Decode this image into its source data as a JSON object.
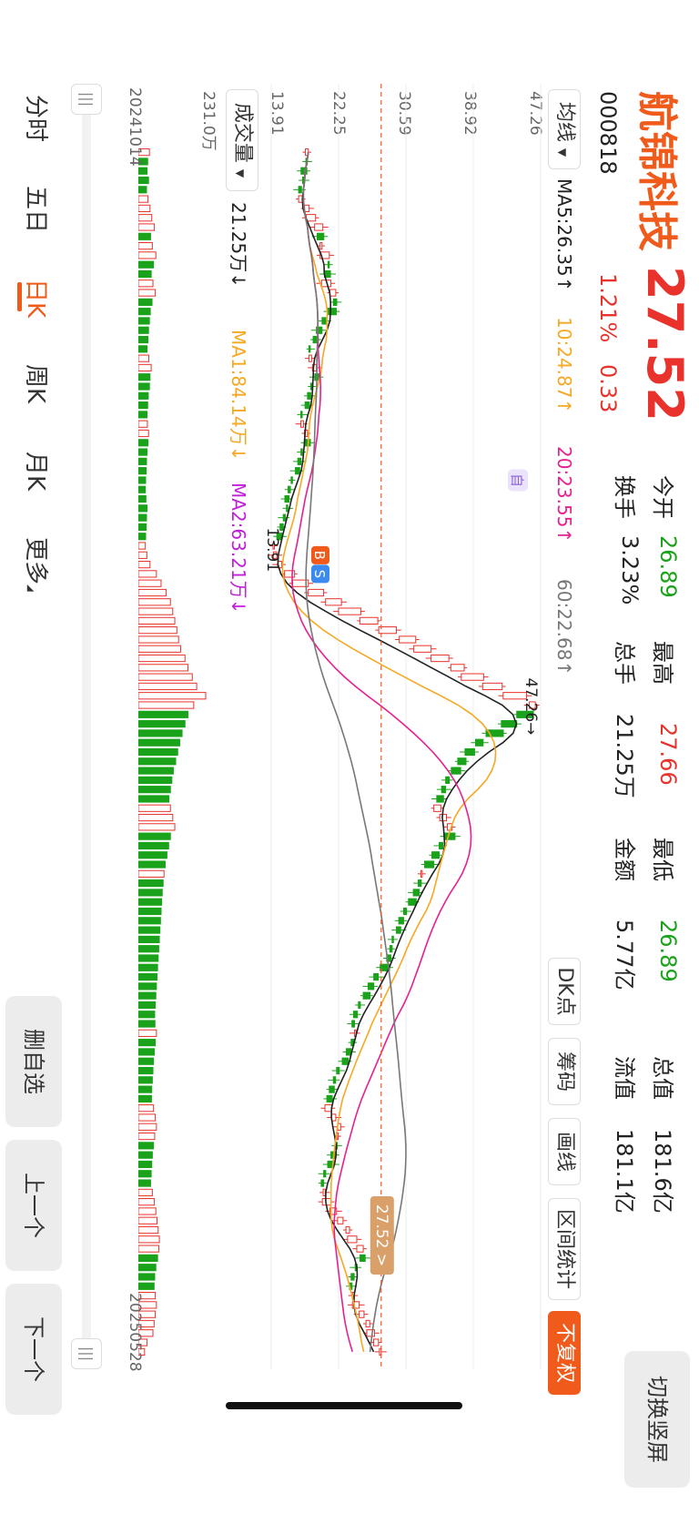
{
  "stock": {
    "name": "航锦科技",
    "code": "000818",
    "price": "27.52",
    "change_pct": "1.21%",
    "change_amt": "0.33"
  },
  "quote": {
    "open_label": "今开",
    "open": "26.89",
    "high_label": "最高",
    "high": "27.66",
    "low_label": "最低",
    "low": "26.89",
    "total_label": "总值",
    "total": "181.6亿",
    "turnover_label": "换手",
    "turnover": "3.23%",
    "volume_label": "总手",
    "volume": "21.25万",
    "amount_label": "金额",
    "amount": "5.77亿",
    "float_label": "流值",
    "float": "181.1亿"
  },
  "switch_btn": "切换竖屏",
  "toolbar": {
    "ma_select": "均线",
    "dk": "DK点",
    "chips": "筹码",
    "draw": "画线",
    "range": "区间统计",
    "fq": "不复权"
  },
  "ma_values": {
    "ma5": "MA5:26.35↑",
    "ma10": "10:24.87↑",
    "ma20": "20:23.55↑",
    "ma60": "60:22.68↑"
  },
  "price_axis": {
    "t1": "47.26",
    "t2": "38.92",
    "t3": "30.59",
    "t4": "22.25",
    "t5": "13.91"
  },
  "annotations": {
    "max": "47.26",
    "min": "13.91",
    "last": "27.52",
    "self": "自",
    "buy": "B",
    "sell": "S"
  },
  "volume": {
    "select": "成交量",
    "value": "21.25万↓",
    "ma1": "MA1:84.14万↓",
    "ma2": "MA2:63.21万↓",
    "axis_top": "231.0万"
  },
  "dates": {
    "start": "20241014",
    "end": "20250528"
  },
  "tabs": [
    "分时",
    "五日",
    "日K",
    "周K",
    "月K",
    "更多"
  ],
  "active_tab": "日K",
  "side_buttons": {
    "delete": "删自选",
    "prev": "上一个",
    "next": "下一个"
  },
  "colors": {
    "up": "#e8322b",
    "down": "#1aa31a",
    "accent": "#f05a1a",
    "ma5": "#222222",
    "ma10": "#f7a823",
    "ma20": "#e6218f",
    "ma60": "#777777"
  },
  "chart_data": {
    "type": "candlestick",
    "ylim": [
      13.91,
      47.26
    ],
    "start": "20241014",
    "end": "20250528",
    "close": [
      18.5,
      18.2,
      17.6,
      17.9,
      17.3,
      17.8,
      18.6,
      19.4,
      20.3,
      19.6,
      20.2,
      21.1,
      21.0,
      20.5,
      21.3,
      21.9,
      21.6,
      20.9,
      20.2,
      19.5,
      19.1,
      18.7,
      18.9,
      19.5,
      19.3,
      18.8,
      18.4,
      18.1,
      17.7,
      17.9,
      18.4,
      18.0,
      17.6,
      17.2,
      16.9,
      16.4,
      16.0,
      15.6,
      15.9,
      15.4,
      15.0,
      14.6,
      14.3,
      14.6,
      15.2,
      16.8,
      18.5,
      20.4,
      22.6,
      25.0,
      27.1,
      29.4,
      31.8,
      33.7,
      35.9,
      37.8,
      40.2,
      42.5,
      45.5,
      46.6,
      44.3,
      42.4,
      40.5,
      39.2,
      37.9,
      37.0,
      36.2,
      35.5,
      35.0,
      34.4,
      34.9,
      35.6,
      36.3,
      35.4,
      34.7,
      33.8,
      32.9,
      32.6,
      32.1,
      31.5,
      30.9,
      30.3,
      29.7,
      29.4,
      29.0,
      28.6,
      28.2,
      27.4,
      26.6,
      25.9,
      25.3,
      24.7,
      24.1,
      23.9,
      24.4,
      23.8,
      23.2,
      22.7,
      22.0,
      21.6,
      21.1,
      20.8,
      21.4,
      21.9,
      22.5,
      22.2,
      21.8,
      21.3,
      20.9,
      20.4,
      20.1,
      20.6,
      21.3,
      22.0,
      22.8,
      23.6,
      24.5,
      25.3,
      24.9,
      24.3,
      23.8,
      23.6,
      24.2,
      24.8,
      25.4,
      26.1,
      26.7,
      27.19,
      27.52
    ],
    "volume": [
      38,
      32,
      30,
      35,
      28,
      33,
      40,
      46,
      55,
      42,
      48,
      60,
      52,
      44,
      50,
      58,
      47,
      41,
      38,
      35,
      33,
      30,
      36,
      44,
      40,
      38,
      34,
      32,
      30,
      31,
      35,
      33,
      30,
      28,
      27,
      25,
      24,
      26,
      30,
      28,
      27,
      25,
      24,
      29,
      40,
      62,
      78,
      95,
      110,
      118,
      125,
      132,
      138,
      145,
      160,
      170,
      185,
      200,
      231,
      190,
      170,
      160,
      150,
      142,
      135,
      128,
      120,
      115,
      110,
      105,
      110,
      118,
      125,
      110,
      104,
      98,
      92,
      88,
      85,
      82,
      80,
      78,
      76,
      74,
      72,
      70,
      68,
      66,
      64,
      62,
      60,
      58,
      56,
      57,
      62,
      58,
      55,
      52,
      50,
      48,
      46,
      45,
      52,
      58,
      62,
      56,
      52,
      48,
      46,
      44,
      42,
      48,
      55,
      60,
      64,
      68,
      72,
      70,
      66,
      60,
      56,
      54,
      58,
      62,
      58,
      54,
      50,
      30,
      21.25
    ],
    "ma_daily": {
      "ma5": "26.35",
      "ma10": "24.87",
      "ma20": "23.55",
      "ma60": "22.68"
    }
  }
}
